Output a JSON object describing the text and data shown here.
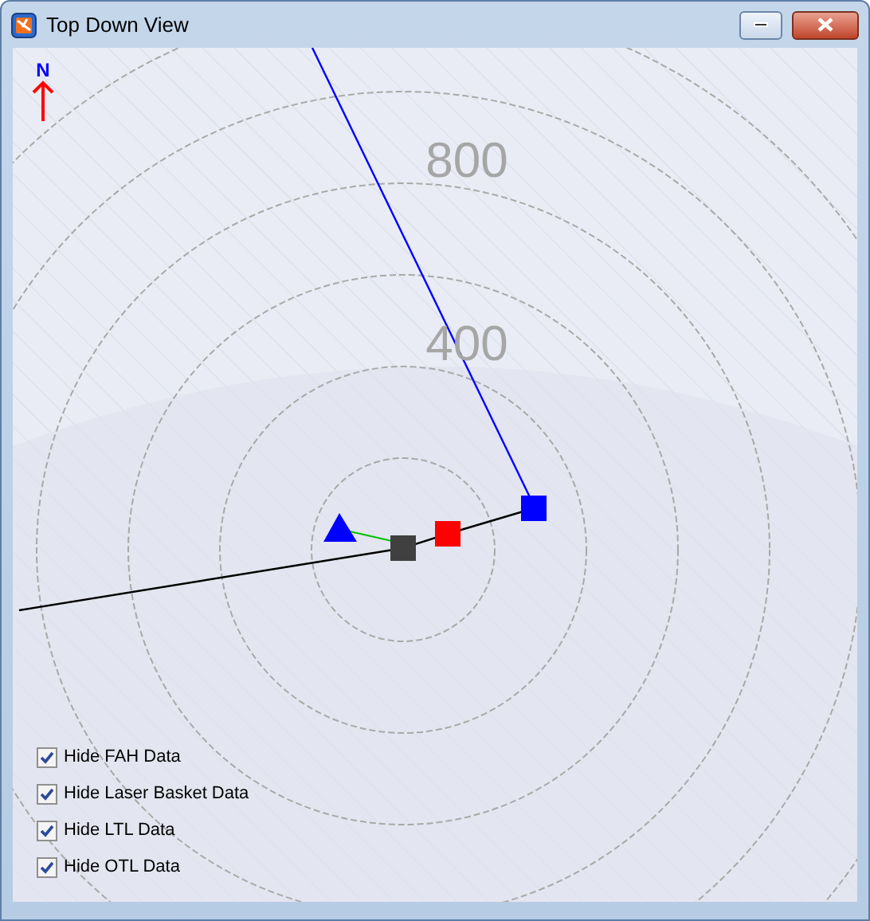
{
  "window": {
    "title": "Top Down View"
  },
  "compass": {
    "label": "N"
  },
  "ring_labels": [
    "800",
    "400"
  ],
  "options": [
    {
      "label": "Hide FAH Data",
      "checked": true
    },
    {
      "label": "Hide Laser Basket Data",
      "checked": true
    },
    {
      "label": "Hide LTL Data",
      "checked": true
    },
    {
      "label": "Hide OTL Data",
      "checked": true
    }
  ]
}
